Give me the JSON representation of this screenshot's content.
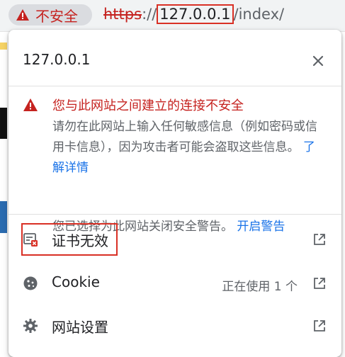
{
  "omnibox": {
    "security_chip_label": "不安全",
    "url_scheme": "https",
    "url_sep": "://",
    "url_host": "127.0.0.1",
    "url_path": "/index/"
  },
  "popup": {
    "site": "127.0.0.1",
    "security": {
      "heading": "您与此网站之间建立的连接不安全",
      "body": "请勿在此网站上输入任何敏感信息（例如密码或信用卡信息），因为攻击者可能会盗取这些信息。",
      "learn_more": "了解详情",
      "warnings_disabled_text": "您已选择为此网站关闭安全警告。",
      "enable_warnings_link": "开启警告"
    },
    "rows": {
      "certificate": {
        "label": "证书无效"
      },
      "cookie": {
        "label": "Cookie",
        "status": "正在使用 1 个"
      },
      "site_settings": {
        "label": "网站设置"
      }
    }
  },
  "colors": {
    "danger": "#c5221f",
    "link": "#1a73e8",
    "highlight_border": "#d93025"
  }
}
